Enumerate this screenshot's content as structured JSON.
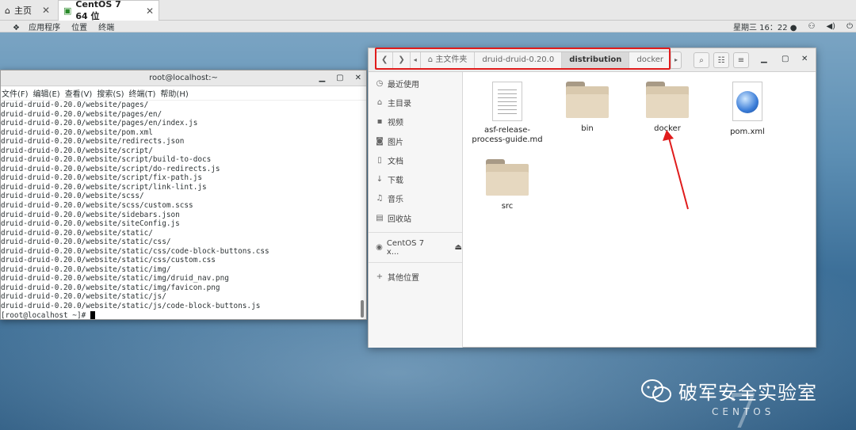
{
  "vm_tabs": [
    {
      "label": "主页",
      "icon": "home-icon"
    },
    {
      "label": "CentOS 7 64 位",
      "icon": "vm-icon"
    }
  ],
  "top_panel": {
    "apps": "应用程序",
    "places": "位置",
    "terminal": "终端",
    "clock": "星期三 16：22 ●"
  },
  "terminal": {
    "title": "root@localhost:~",
    "menu": [
      "文件(F)",
      "编辑(E)",
      "查看(V)",
      "搜索(S)",
      "终端(T)",
      "帮助(H)"
    ],
    "lines": [
      "druid-druid-0.20.0/website/pages/",
      "druid-druid-0.20.0/website/pages/en/",
      "druid-druid-0.20.0/website/pages/en/index.js",
      "druid-druid-0.20.0/website/pom.xml",
      "druid-druid-0.20.0/website/redirects.json",
      "druid-druid-0.20.0/website/script/",
      "druid-druid-0.20.0/website/script/build-to-docs",
      "druid-druid-0.20.0/website/script/do-redirects.js",
      "druid-druid-0.20.0/website/script/fix-path.js",
      "druid-druid-0.20.0/website/script/link-lint.js",
      "druid-druid-0.20.0/website/scss/",
      "druid-druid-0.20.0/website/scss/custom.scss",
      "druid-druid-0.20.0/website/sidebars.json",
      "druid-druid-0.20.0/website/siteConfig.js",
      "druid-druid-0.20.0/website/static/",
      "druid-druid-0.20.0/website/static/css/",
      "druid-druid-0.20.0/website/static/css/code-block-buttons.css",
      "druid-druid-0.20.0/website/static/css/custom.css",
      "druid-druid-0.20.0/website/static/img/",
      "druid-druid-0.20.0/website/static/img/druid_nav.png",
      "druid-druid-0.20.0/website/static/img/favicon.png",
      "druid-druid-0.20.0/website/static/js/",
      "druid-druid-0.20.0/website/static/js/code-block-buttons.js"
    ],
    "prompt": "[root@localhost ~]# "
  },
  "files": {
    "path": [
      "主文件夹",
      "druid-druid-0.20.0",
      "distribution",
      "docker"
    ],
    "sidebar": [
      {
        "icon": "clock-icon",
        "label": "最近使用"
      },
      {
        "icon": "home-icon",
        "label": "主目录"
      },
      {
        "icon": "video-icon",
        "label": "视频"
      },
      {
        "icon": "camera-icon",
        "label": "图片"
      },
      {
        "icon": "document-icon",
        "label": "文档"
      },
      {
        "icon": "download-icon",
        "label": "下载"
      },
      {
        "icon": "music-icon",
        "label": "音乐"
      },
      {
        "icon": "trash-icon",
        "label": "回收站"
      }
    ],
    "device": "CentOS 7 x...",
    "other": "其他位置",
    "items": [
      {
        "name": "asf-release-process-guide.md",
        "type": "text-file"
      },
      {
        "name": "bin",
        "type": "folder"
      },
      {
        "name": "docker",
        "type": "folder"
      },
      {
        "name": "pom.xml",
        "type": "xml-file"
      },
      {
        "name": "src",
        "type": "folder"
      }
    ]
  },
  "watermark": {
    "text": "破军安全实验室",
    "sub": "CENTOS",
    "version": "7"
  },
  "colors": {
    "highlight_box": "#e01c1c",
    "arrow": "#e01c1c"
  }
}
